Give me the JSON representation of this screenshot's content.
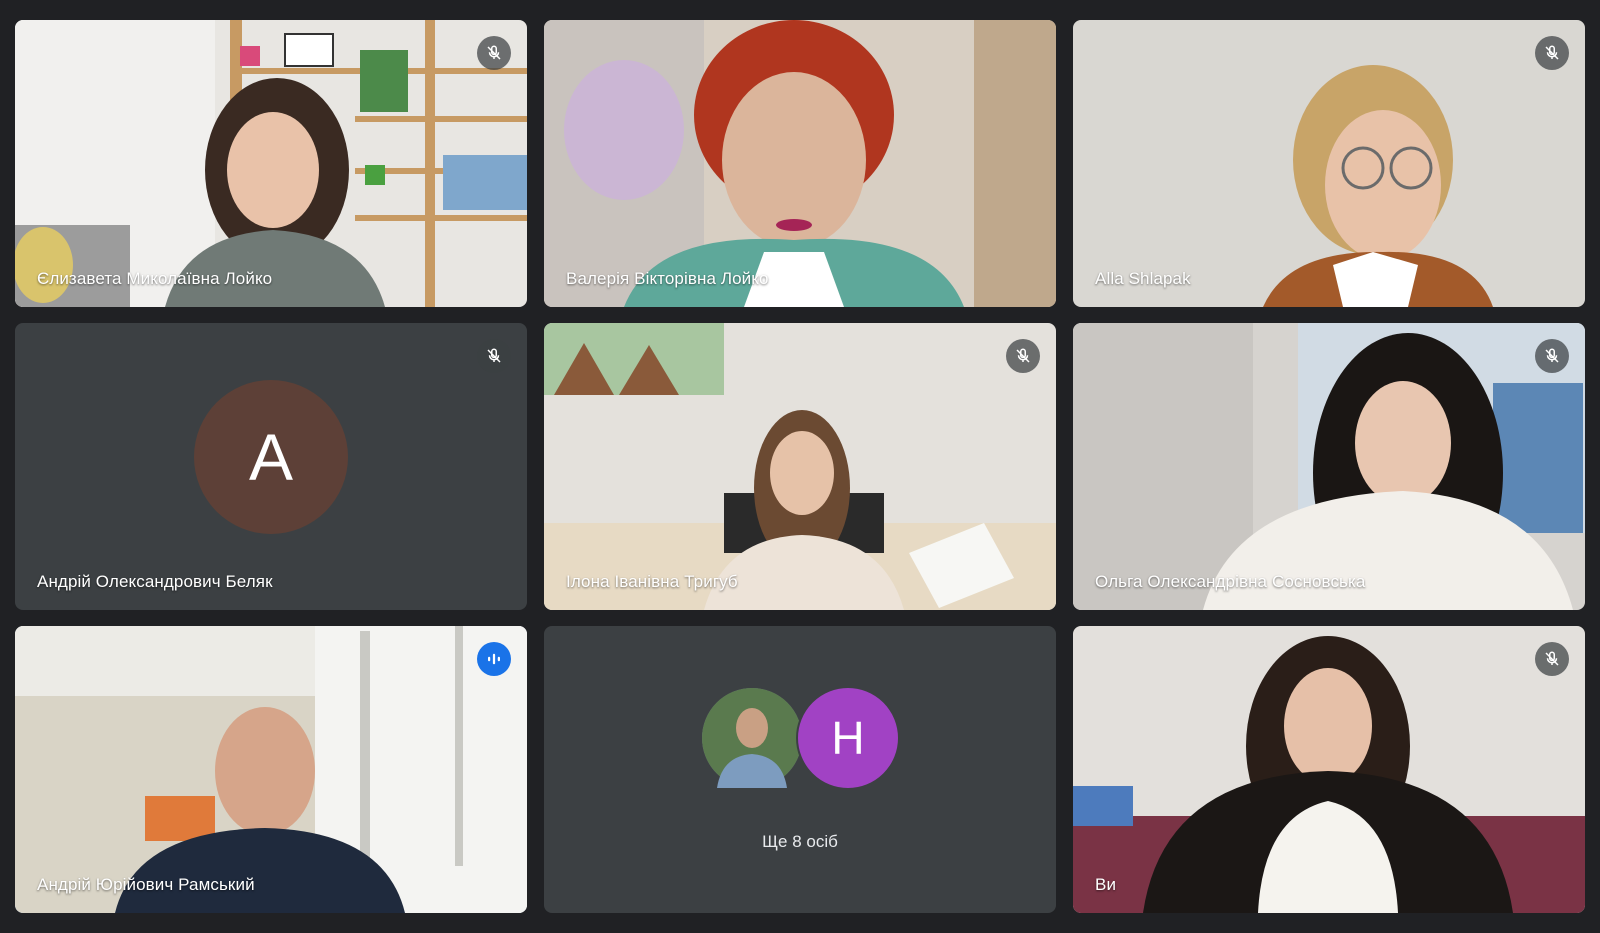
{
  "colors": {
    "background": "#202124",
    "tile": "#3c4043",
    "active_border": "#8ab4f8",
    "speaking_indicator": "#1a73e8",
    "avatar_a": "#5d4037",
    "avatar_h": "#a142c4"
  },
  "participants": [
    {
      "name": "Єлизавета Миколаївна Лойко",
      "muted": true
    },
    {
      "name": "Валерія Вікторівна Лойко",
      "muted": false
    },
    {
      "name": "Alla Shlapak",
      "muted": true
    },
    {
      "name": "Андрій Олександрович Беляк",
      "muted": true,
      "avatar_letter": "A"
    },
    {
      "name": "Ілона Іванівна Тригуб",
      "muted": true
    },
    {
      "name": "Ольга Олександрівна Сосновська",
      "muted": true
    },
    {
      "name": "Андрій Юрійович Рамський",
      "speaking": true
    },
    {
      "name": "Ви",
      "muted": true
    }
  ],
  "others": {
    "label": "Ще 8 осіб",
    "avatar_letter": "H"
  },
  "icons": {
    "muted": "mic-off-icon",
    "speaking": "audio-level-icon"
  }
}
